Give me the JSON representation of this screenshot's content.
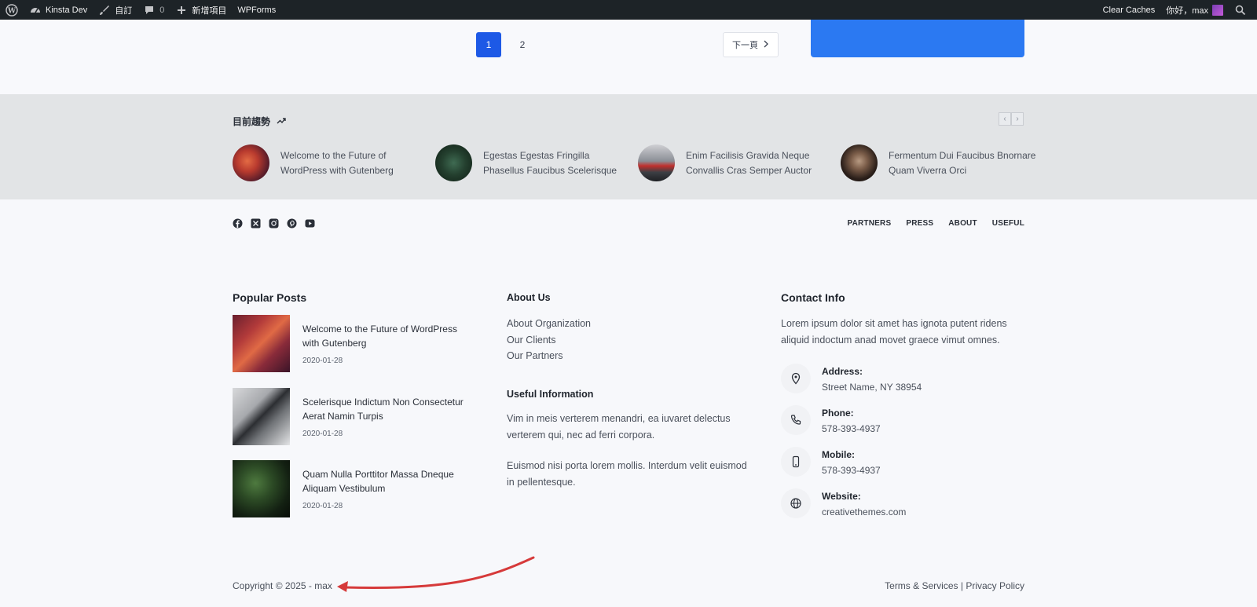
{
  "adminbar": {
    "site_name": "Kinsta Dev",
    "customize": "自訂",
    "comments_count": "0",
    "new_item": "新增項目",
    "wpforms": "WPForms",
    "clear_caches": "Clear Caches",
    "greeting": "你好，max"
  },
  "pagination": {
    "pages": [
      "1",
      "2"
    ],
    "next": "下一頁"
  },
  "trending": {
    "title": "目前趨勢",
    "items": [
      {
        "title": "Welcome to the Future of WordPress with Gutenberg"
      },
      {
        "title": "Egestas Egestas Fringilla Phasellus Faucibus Scelerisque"
      },
      {
        "title": "Enim Facilisis Gravida Neque Convallis Cras Semper Auctor"
      },
      {
        "title": "Fermentum Dui Faucibus Bnornare Quam Viverra Orci"
      }
    ]
  },
  "footer_nav": [
    "PARTNERS",
    "PRESS",
    "ABOUT",
    "USEFUL"
  ],
  "social_icons": [
    "facebook-icon",
    "x-icon",
    "instagram-icon",
    "pinterest-icon",
    "youtube-icon"
  ],
  "popular_posts": {
    "title": "Popular Posts",
    "items": [
      {
        "title": "Welcome to the Future of WordPress with Gutenberg",
        "date": "2020-01-28"
      },
      {
        "title": "Scelerisque Indictum Non Consectetur Aerat Namin Turpis",
        "date": "2020-01-28"
      },
      {
        "title": "Quam Nulla Porttitor Massa Dneque Aliquam Vestibulum",
        "date": "2020-01-28"
      }
    ]
  },
  "about_us": {
    "title": "About Us",
    "links": [
      "About Organization",
      "Our Clients",
      "Our Partners"
    ]
  },
  "useful_info": {
    "title": "Useful Information",
    "para1": "Vim in meis verterem menandri, ea iuvaret delectus verterem qui, nec ad ferri corpora.",
    "para2": "Euismod nisi porta lorem mollis. Interdum velit euismod in pellentesque."
  },
  "contact": {
    "title": "Contact Info",
    "intro": "Lorem ipsum dolor sit amet has ignota putent ridens aliquid indoctum anad movet graece vimut omnes.",
    "items": [
      {
        "label": "Address:",
        "value": "Street Name, NY 38954",
        "icon": "map-pin-icon"
      },
      {
        "label": "Phone:",
        "value": "578-393-4937",
        "icon": "phone-icon"
      },
      {
        "label": "Mobile:",
        "value": "578-393-4937",
        "icon": "mobile-icon"
      },
      {
        "label": "Website:",
        "value": "creativethemes.com",
        "icon": "globe-icon"
      }
    ]
  },
  "bottom": {
    "copyright": "Copyright © 2025 - max",
    "terms": "Terms & Services",
    "separator": "|",
    "privacy": "Privacy Policy"
  },
  "colors": {
    "accent": "#1d59e6",
    "adminbar": "#1d2327",
    "annotation_arrow": "#d63a3a"
  }
}
